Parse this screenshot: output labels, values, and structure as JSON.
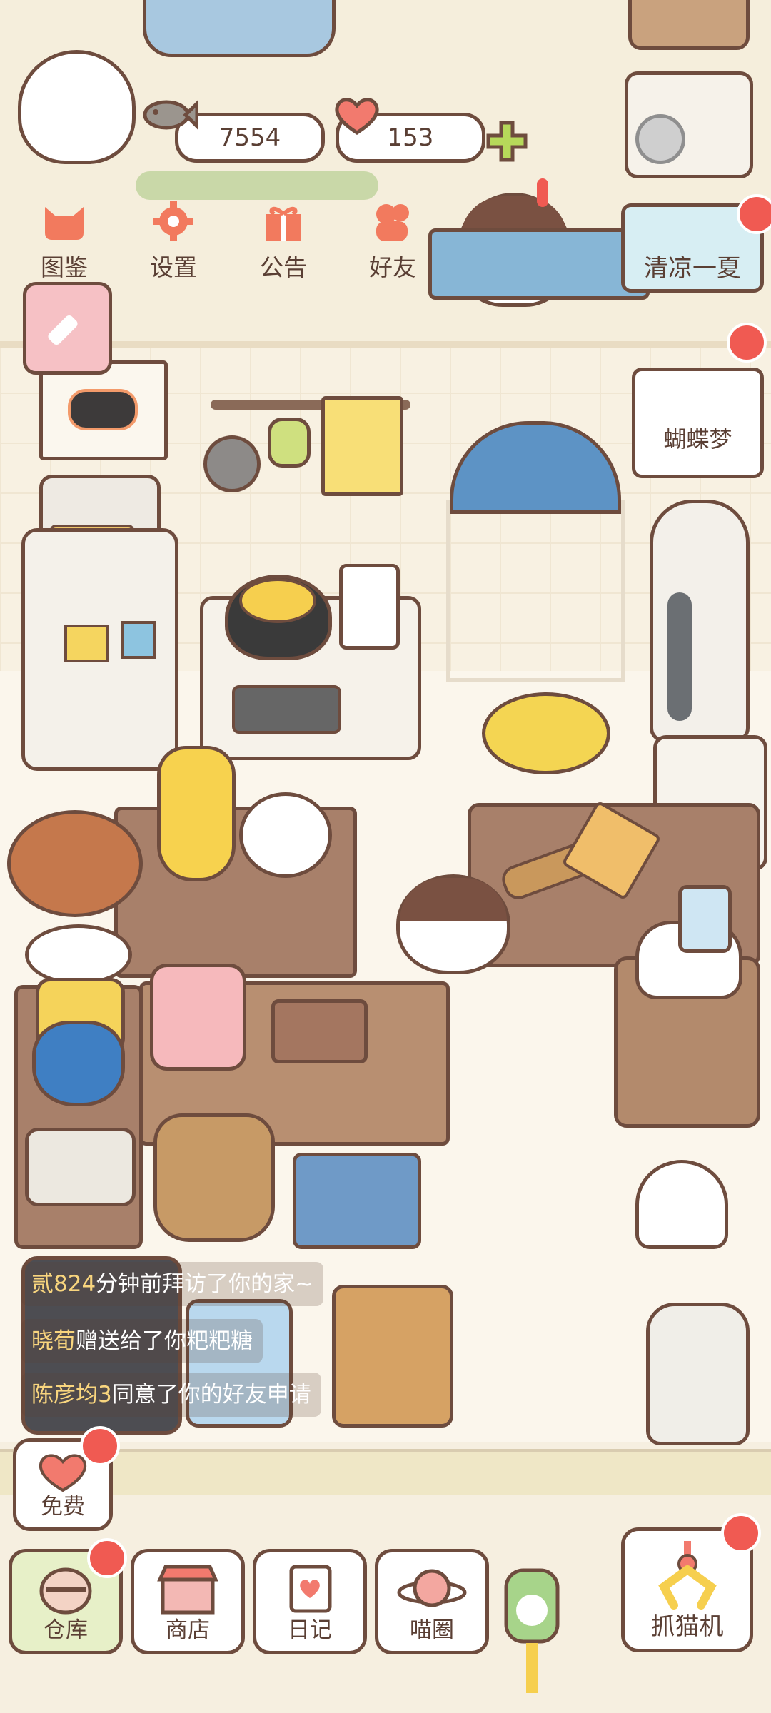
{
  "currency": {
    "fish_count": "7554",
    "heart_count": "153"
  },
  "top_menu": [
    {
      "label": "图鉴",
      "icon": "cat-head-icon"
    },
    {
      "label": "设置",
      "icon": "gear-icon"
    },
    {
      "label": "公告",
      "icon": "gift-icon"
    },
    {
      "label": "好友",
      "icon": "friends-icon"
    }
  ],
  "events": {
    "summer_label": "清凉一夏",
    "butterfly_label": "蝴蝶梦"
  },
  "feed": [
    {
      "name": "贰824",
      "text": "分钟前拜访了你的家~"
    },
    {
      "name": "晓荀",
      "text": "赠送给了你粑粑糖"
    },
    {
      "name": "陈彦均3",
      "text": "同意了你的好友申请"
    }
  ],
  "free_button": {
    "label": "免费"
  },
  "bottom_nav": [
    {
      "label": "仓库",
      "icon": "warehouse-icon"
    },
    {
      "label": "商店",
      "icon": "shop-icon"
    },
    {
      "label": "日记",
      "icon": "diary-icon"
    },
    {
      "label": "喵圈",
      "icon": "planet-icon"
    }
  ],
  "claw_machine": {
    "label": "抓猫机"
  },
  "colors": {
    "outline": "#6e4c3e",
    "accent": "#f27a5e",
    "badge": "#f05a52",
    "background": "#f6efe0"
  }
}
